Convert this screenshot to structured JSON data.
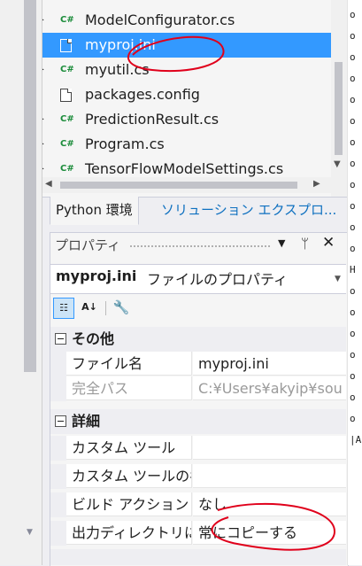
{
  "solution_explorer": {
    "items": [
      {
        "name": "ModelConfigurator.cs",
        "icon": "csharp-file-icon",
        "icon_glyph": "C#",
        "expandable": true
      },
      {
        "name": "myproj.ini",
        "icon": "settings-file-icon",
        "icon_glyph": "",
        "expandable": false,
        "selected": true
      },
      {
        "name": "myutil.cs",
        "icon": "csharp-file-icon",
        "icon_glyph": "C#",
        "expandable": true
      },
      {
        "name": "packages.config",
        "icon": "config-file-icon",
        "icon_glyph": "",
        "expandable": false
      },
      {
        "name": "PredictionResult.cs",
        "icon": "csharp-file-icon",
        "icon_glyph": "C#",
        "expandable": true
      },
      {
        "name": "Program.cs",
        "icon": "csharp-file-icon",
        "icon_glyph": "C#",
        "expandable": true
      },
      {
        "name": "TensorFlowModelSettings.cs",
        "icon": "csharp-file-icon",
        "icon_glyph": "C#",
        "expandable": true
      }
    ]
  },
  "tabs": [
    {
      "label": "Python 環境",
      "active": true
    },
    {
      "label": "ソリューション エクスプロ...",
      "active": false
    }
  ],
  "properties": {
    "title": "プロパティ",
    "pin_glyph": "ᛘ",
    "close_glyph": "✕",
    "menu_glyph": "▼",
    "object_name": "myproj.ini",
    "object_desc": "ファイルのプロパティ",
    "toolbar": {
      "categorized_glyph": "☷",
      "alphabetical_glyph": "A↓",
      "property_pages_glyph": "🔧"
    },
    "categories": [
      {
        "label": "その他",
        "rows": [
          {
            "name": "ファイル名",
            "value": "myproj.ini",
            "disabled": false
          },
          {
            "name": "完全パス",
            "value": "C:¥Users¥akyip¥sou",
            "disabled": true
          }
        ]
      },
      {
        "label": "詳細",
        "rows": [
          {
            "name": "カスタム ツール",
            "value": "",
            "disabled": false
          },
          {
            "name": "カスタム ツールの名",
            "value": "",
            "disabled": false
          },
          {
            "name": "ビルド アクション",
            "value": "なし",
            "disabled": false
          },
          {
            "name": "出力ディレクトリに",
            "value": "常にコピーする",
            "disabled": false
          }
        ]
      }
    ]
  },
  "edge_text": [
    "o",
    "o",
    "o",
    "o",
    "o",
    "o",
    "o",
    "o",
    "o",
    "o",
    "o",
    "o",
    "H",
    "o",
    "o",
    "o",
    "o",
    "o",
    "o",
    "o",
    "|A"
  ],
  "colors": {
    "selection": "#3399ff",
    "annotation_red": "#e0001b",
    "csharp_icon": "#1b8c3a",
    "link_blue": "#0e70c0"
  }
}
